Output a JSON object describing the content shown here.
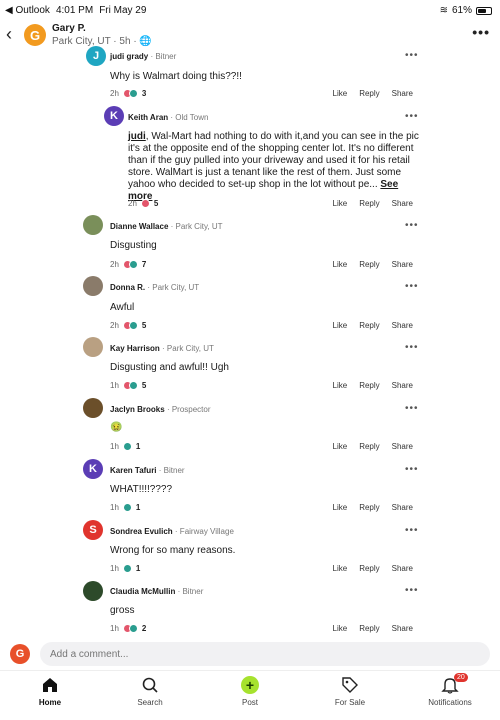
{
  "status": {
    "back_app": "◀ Outlook",
    "time": "4:01 PM",
    "date": "Fri May 29",
    "battery": "61%"
  },
  "header": {
    "avatar_letter": "G",
    "name": "Gary P.",
    "sub": "Park City, UT · 5h · 🌐"
  },
  "comments": [
    {
      "avatar": "J",
      "name": "judi grady",
      "loc": "· Bitner",
      "text": "Why is Walmart doing this??!!",
      "time": "2h",
      "count": "3",
      "reactions": "heart+thumb"
    },
    {
      "avatar": "K",
      "name": "Keith Aran",
      "loc": "· Old Town",
      "mention": "judi",
      "text": ", Wal-Mart had nothing to do with it,and you can see in the pic it's at the opposite end of the shopping center lot. It's no different than if the guy pulled into your driveway and used it for his retail store. WalMart is just a tenant like the rest of them. Just some yahoo who decided to set-up shop in the lot without pe...",
      "see_more": "See more",
      "time": "2h",
      "count": "5",
      "reactions": "heart"
    },
    {
      "avatar": "",
      "name": "Dianne Wallace",
      "loc": "· Park City, UT",
      "text": "Disgusting",
      "time": "2h",
      "count": "7",
      "reactions": "heart+thumb"
    },
    {
      "avatar": "",
      "name": "Donna R.",
      "loc": "· Park City, UT",
      "text": "Awful",
      "time": "2h",
      "count": "5",
      "reactions": "heart+thumb"
    },
    {
      "avatar": "",
      "name": "Kay Harrison",
      "loc": "· Park City, UT",
      "text": "Disgusting and awful!! Ugh",
      "time": "1h",
      "count": "5",
      "reactions": "heart+thumb"
    },
    {
      "avatar": "",
      "name": "Jaclyn Brooks",
      "loc": "· Prospector",
      "text": "🤢",
      "time": "1h",
      "count": "1",
      "reactions": "thumb"
    },
    {
      "avatar": "K",
      "name": "Karen Tafuri",
      "loc": "· Bitner",
      "text": "WHAT!!!!????",
      "time": "1h",
      "count": "1",
      "reactions": "thumb"
    },
    {
      "avatar": "S",
      "name": "Sondrea Evulich",
      "loc": "· Fairway Village",
      "text": "Wrong for so many reasons.",
      "time": "1h",
      "count": "1",
      "reactions": "thumb"
    },
    {
      "avatar": "",
      "name": "Claudia McMullin",
      "loc": "· Bitner",
      "text": "gross",
      "time": "1h",
      "count": "2",
      "reactions": "heart+thumb"
    }
  ],
  "actions": {
    "like": "Like",
    "reply": "Reply",
    "share": "Share"
  },
  "add_comment": {
    "avatar": "G",
    "placeholder": "Add a comment..."
  },
  "nav": {
    "home": "Home",
    "search": "Search",
    "post": "Post",
    "for_sale": "For Sale",
    "notifications": "Notifications",
    "notif_count": "20"
  },
  "colors": {
    "accent": "#a6e22e",
    "orange": "#f29a1f",
    "purple": "#5b3db5",
    "teal": "#2a9d8f",
    "red": "#e8502a"
  }
}
